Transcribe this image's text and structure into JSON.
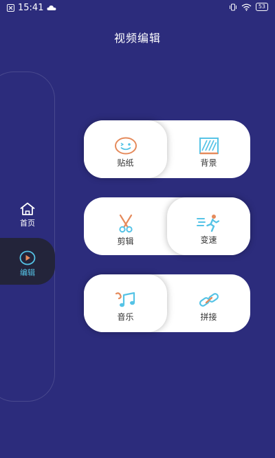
{
  "status_bar": {
    "time": "15:41",
    "battery": "53"
  },
  "header": {
    "title": "视频编辑"
  },
  "sidebar": {
    "items": [
      {
        "label": "首页",
        "icon": "home-icon",
        "active": false
      },
      {
        "label": "编辑",
        "icon": "play-circle-icon",
        "active": true
      }
    ]
  },
  "tools": [
    {
      "label": "贴纸",
      "icon": "smiley-icon"
    },
    {
      "label": "背景",
      "icon": "background-icon"
    },
    {
      "label": "剪辑",
      "icon": "scissors-icon"
    },
    {
      "label": "变速",
      "icon": "running-person-icon"
    },
    {
      "label": "音乐",
      "icon": "music-note-icon"
    },
    {
      "label": "拼接",
      "icon": "link-icon"
    }
  ],
  "colors": {
    "background": "#2c2c7c",
    "sidebar_active": "#23243a",
    "accent_blue": "#55c3e6",
    "accent_orange": "#e58a5b",
    "card": "#ffffff"
  }
}
